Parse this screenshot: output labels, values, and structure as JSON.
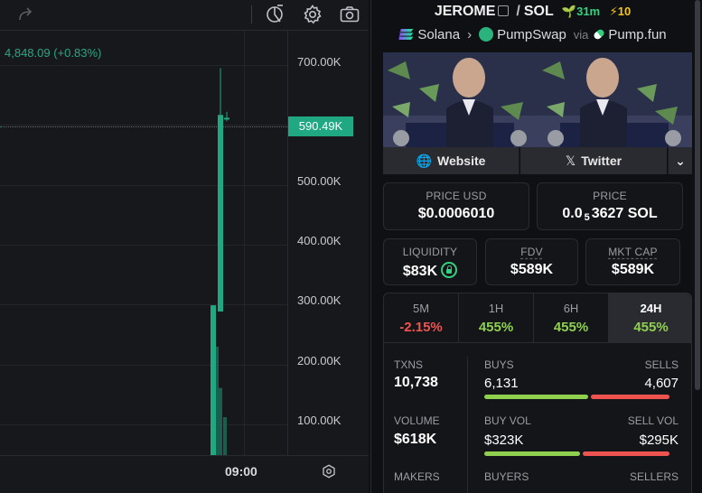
{
  "chart": {
    "price_change": "4,848.09 (+0.83%)",
    "current_price_tag": "590.49K",
    "y_labels": [
      "700.00K",
      "500.00K",
      "400.00K",
      "300.00K",
      "200.00K",
      "100.00K"
    ],
    "x_label": "09:00"
  },
  "chart_data": {
    "type": "candlestick",
    "ylim": [
      50000,
      730000
    ],
    "candles": [
      {
        "open": 50000,
        "high": 290000,
        "low": 50000,
        "close": 290000
      },
      {
        "open": 280000,
        "high": 670000,
        "low": 280000,
        "close": 595000
      },
      {
        "open": 590000,
        "high": 600000,
        "low": 585000,
        "close": 590490
      }
    ],
    "volume_bars": [
      0.45,
      1.0,
      0.62,
      0.35
    ]
  },
  "token": {
    "name": "JEROME",
    "quote": "SOL",
    "age": "31m",
    "boosts": "10",
    "chain": "Solana",
    "dex": "PumpSwap",
    "via_label": "via",
    "launchpad": "Pump.fun"
  },
  "links": {
    "website": "Website",
    "twitter": "Twitter"
  },
  "metrics": {
    "price_usd_label": "PRICE USD",
    "price_usd": "$0.0006010",
    "price_label": "PRICE",
    "price_prefix": "0.0",
    "price_sub": "5",
    "price_suffix": "3627 SOL",
    "liquidity_label": "LIQUIDITY",
    "liquidity": "$83K",
    "fdv_label": "FDV",
    "fdv": "$589K",
    "mktcap_label": "MKT CAP",
    "mktcap": "$589K"
  },
  "timeframes": [
    {
      "label": "5M",
      "value": "-2.15%"
    },
    {
      "label": "1H",
      "value": "455%"
    },
    {
      "label": "6H",
      "value": "455%"
    },
    {
      "label": "24H",
      "value": "455%"
    }
  ],
  "stats": {
    "txns_label": "TXNS",
    "txns": "10,738",
    "buys_label": "BUYS",
    "buys": "6,131",
    "sells_label": "SELLS",
    "sells": "4,607",
    "volume_label": "VOLUME",
    "volume": "$618K",
    "buy_vol_label": "BUY VOL",
    "buy_vol": "$323K",
    "sell_vol_label": "SELL VOL",
    "sell_vol": "$295K",
    "makers_label": "MAKERS",
    "buyers_label": "BUYERS",
    "sellers_label": "SELLERS",
    "buys_ratio": 0.571,
    "buy_vol_ratio": 0.523
  },
  "colors": {
    "up": "#1fa882",
    "down": "#ef5350",
    "positive": "#8fd14f"
  }
}
